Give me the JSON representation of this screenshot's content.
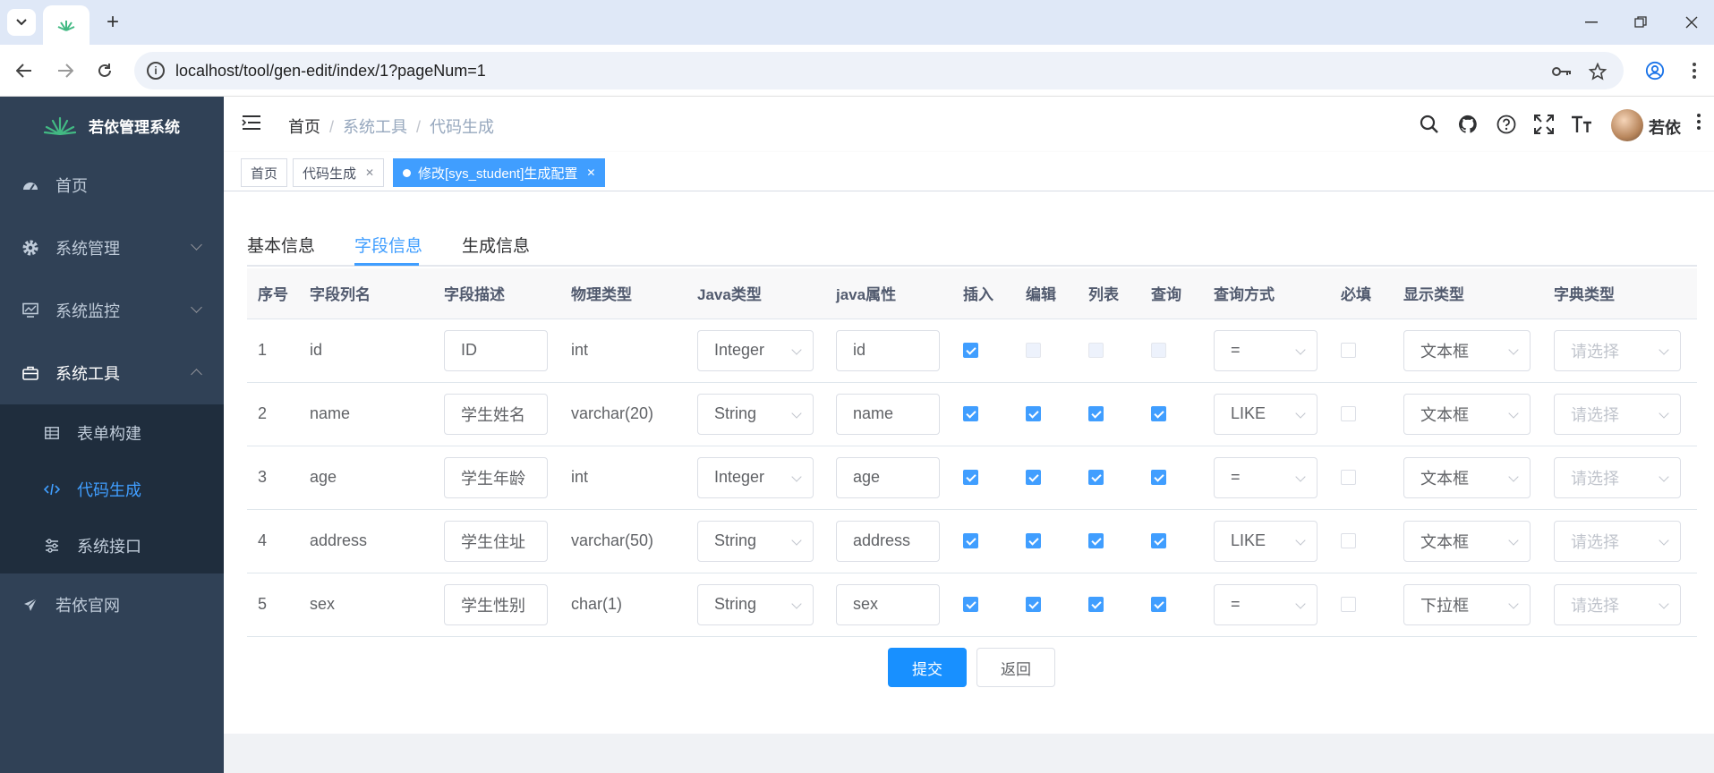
{
  "browser": {
    "url": "localhost/tool/gen-edit/index/1?pageNum=1"
  },
  "sidebar": {
    "app_title": "若依管理系统",
    "items": [
      {
        "label": "首页",
        "icon": "dashboard-icon"
      },
      {
        "label": "系统管理",
        "icon": "gear-icon"
      },
      {
        "label": "系统监控",
        "icon": "monitor-icon"
      },
      {
        "label": "系统工具",
        "icon": "toolbox-icon"
      },
      {
        "label": "若依官网",
        "icon": "send-icon"
      }
    ],
    "subitems": [
      {
        "label": "表单构建",
        "icon": "table-icon"
      },
      {
        "label": "代码生成",
        "icon": "code-icon"
      },
      {
        "label": "系统接口",
        "icon": "sliders-icon"
      }
    ]
  },
  "navbar": {
    "breadcrumb": [
      "首页",
      "系统工具",
      "代码生成"
    ],
    "user_name": "若依"
  },
  "tags": [
    {
      "label": "首页"
    },
    {
      "label": "代码生成"
    },
    {
      "label": "修改[sys_student]生成配置"
    }
  ],
  "tabs": [
    "基本信息",
    "字段信息",
    "生成信息"
  ],
  "table": {
    "headers": [
      "序号",
      "字段列名",
      "字段描述",
      "物理类型",
      "Java类型",
      "java属性",
      "插入",
      "编辑",
      "列表",
      "查询",
      "查询方式",
      "必填",
      "显示类型",
      "字典类型"
    ],
    "dict_placeholder": "请选择",
    "rows": [
      {
        "no": "1",
        "column": "id",
        "desc": "ID",
        "phys": "int",
        "java_type": "Integer",
        "java_field": "id",
        "insert": true,
        "edit": false,
        "list": false,
        "query": false,
        "query_type": "=",
        "required": false,
        "html_type": "文本框"
      },
      {
        "no": "2",
        "column": "name",
        "desc": "学生姓名",
        "phys": "varchar(20)",
        "java_type": "String",
        "java_field": "name",
        "insert": true,
        "edit": true,
        "list": true,
        "query": true,
        "query_type": "LIKE",
        "required": false,
        "html_type": "文本框"
      },
      {
        "no": "3",
        "column": "age",
        "desc": "学生年龄",
        "phys": "int",
        "java_type": "Integer",
        "java_field": "age",
        "insert": true,
        "edit": true,
        "list": true,
        "query": true,
        "query_type": "=",
        "required": false,
        "html_type": "文本框"
      },
      {
        "no": "4",
        "column": "address",
        "desc": "学生住址",
        "phys": "varchar(50)",
        "java_type": "String",
        "java_field": "address",
        "insert": true,
        "edit": true,
        "list": true,
        "query": true,
        "query_type": "LIKE",
        "required": false,
        "html_type": "文本框"
      },
      {
        "no": "5",
        "column": "sex",
        "desc": "学生性别",
        "phys": "char(1)",
        "java_type": "String",
        "java_field": "sex",
        "insert": true,
        "edit": true,
        "list": true,
        "query": true,
        "query_type": "=",
        "required": false,
        "html_type": "下拉框"
      }
    ]
  },
  "actions": {
    "submit": "提交",
    "back": "返回"
  },
  "colors": {
    "sidebar_bg": "#304156",
    "accent": "#409eff",
    "submenu_bg": "#1f2d3d"
  }
}
